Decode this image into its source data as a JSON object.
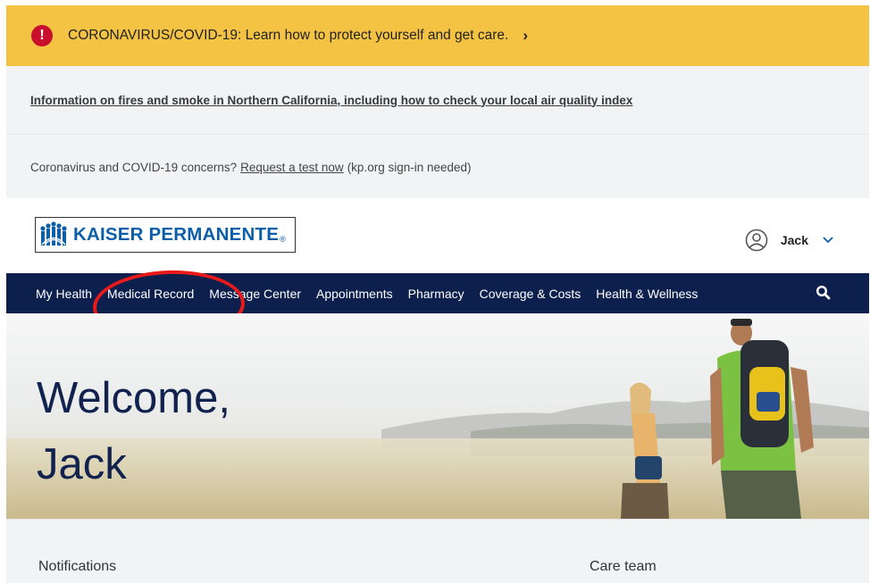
{
  "covid_banner": {
    "text": "CORONAVIRUS/COVID-19: Learn how to protect yourself and get care.",
    "alert_symbol": "!",
    "chevron": "›",
    "icon": "alert-circle-icon",
    "background": "#f5c344"
  },
  "fires_notice": {
    "link_text": "Information on fires and smoke in Northern California, including how to check your local air quality index"
  },
  "test_notice": {
    "prefix": "Coronavirus and COVID-19 concerns?",
    "link_text": "Request a test now",
    "suffix": "(kp.org sign-in needed)"
  },
  "header": {
    "logo_text": "KAISER PERMANENTE",
    "logo_mark": "®",
    "user_name": "Jack",
    "caret": "⌄"
  },
  "nav": {
    "items": [
      "My Health",
      "Medical Record",
      "Message Center",
      "Appointments",
      "Pharmacy",
      "Coverage & Costs",
      "Health & Wellness"
    ],
    "search_icon": "search-icon",
    "background": "#0d1f4d"
  },
  "hero": {
    "line1": "Welcome,",
    "line2": "Jack"
  },
  "sections": {
    "notifications": "Notifications",
    "care_team": "Care team"
  },
  "colors": {
    "brand_blue": "#0b5ea8",
    "annotation_red": "#e81a1a"
  }
}
